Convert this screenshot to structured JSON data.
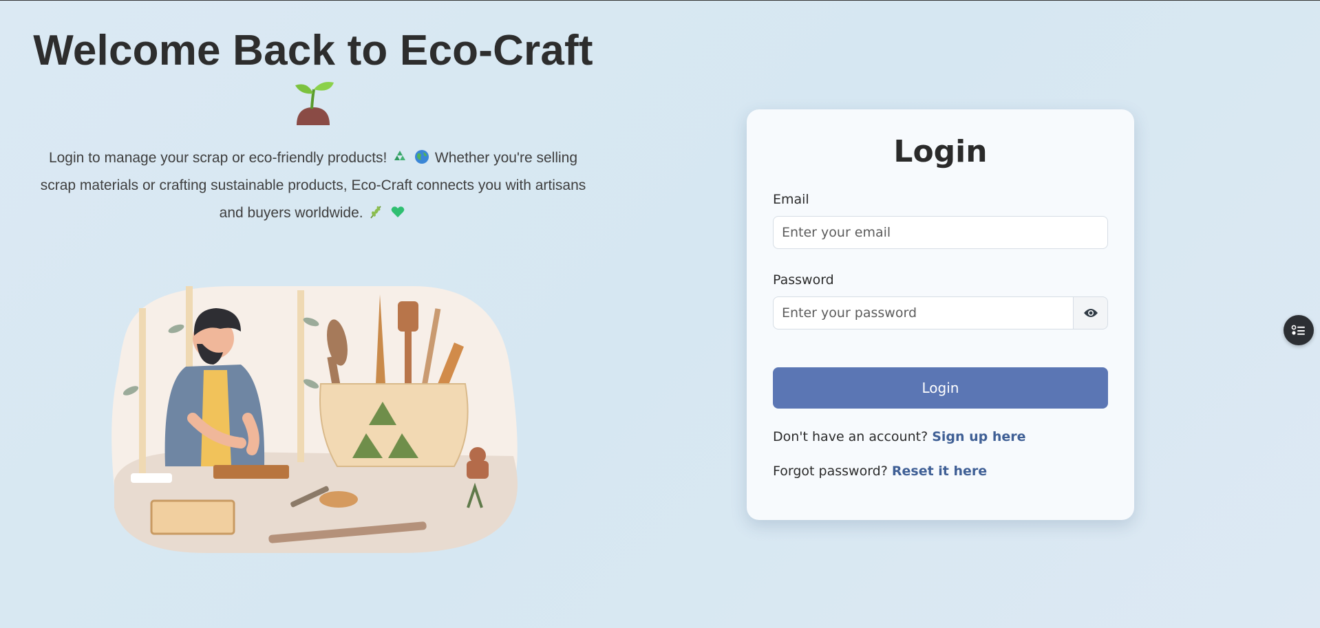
{
  "hero": {
    "title": "Welcome Back to Eco-Craft",
    "description_part1": "Login to manage your scrap or eco-friendly products!",
    "description_part2": "Whether you're selling scrap materials or crafting sustainable products, Eco-Craft connects you with artisans and buyers worldwide.",
    "icons": [
      "sprout-icon",
      "recycle-icon",
      "globe-icon",
      "herb-icon",
      "green-heart-icon"
    ]
  },
  "login": {
    "title": "Login",
    "email_label": "Email",
    "email_placeholder": "Enter your email",
    "password_label": "Password",
    "password_placeholder": "Enter your password",
    "submit_label": "Login",
    "signup_prompt": "Don't have an account?",
    "signup_link": "Sign up here",
    "forgot_prompt": "Forgot password?",
    "forgot_link": "Reset it here"
  },
  "colors": {
    "primary": "#5b76b4",
    "link": "#3f5f95",
    "background": "#dbe9f3",
    "card": "#f7fafd"
  }
}
